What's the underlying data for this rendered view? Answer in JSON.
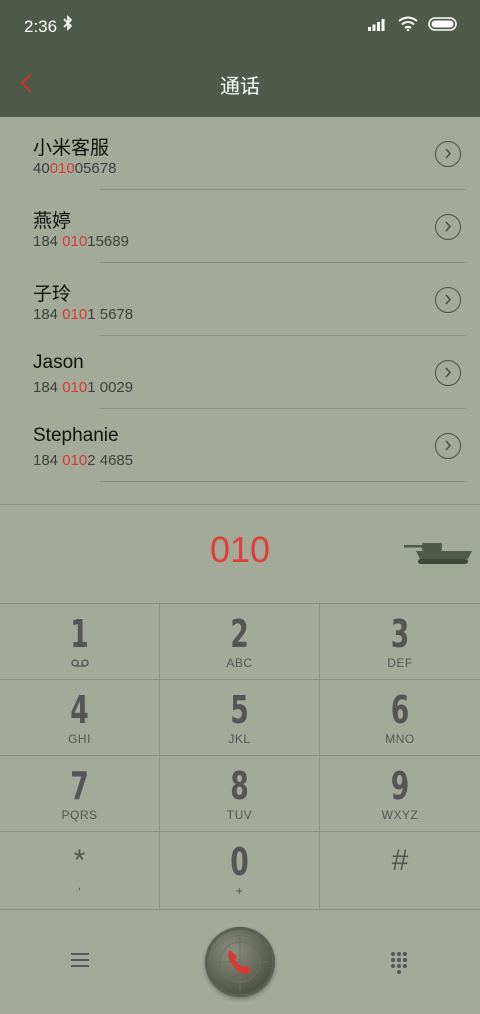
{
  "status": {
    "time": "2:36"
  },
  "header": {
    "title": "通话"
  },
  "contacts": [
    {
      "name": "小米客服",
      "num_pre": "40",
      "num_hl": "010",
      "num_post": "05678"
    },
    {
      "name": "燕婷",
      "num_pre": "184 ",
      "num_hl": "010",
      "num_post": "15689"
    },
    {
      "name": "子玲",
      "num_pre": "184 ",
      "num_hl": "010",
      "num_post": "1 5678"
    },
    {
      "name": "Jason",
      "num_pre": "184 ",
      "num_hl": "010",
      "num_post": "1 0029"
    },
    {
      "name": "Stephanie",
      "num_pre": "184 ",
      "num_hl": "010",
      "num_post": "2 4685"
    }
  ],
  "dial_input": {
    "value": "010"
  },
  "keypad": [
    {
      "digit": "1",
      "sub": ""
    },
    {
      "digit": "2",
      "sub": "ABC"
    },
    {
      "digit": "3",
      "sub": "DEF"
    },
    {
      "digit": "4",
      "sub": "GHI"
    },
    {
      "digit": "5",
      "sub": "JKL"
    },
    {
      "digit": "6",
      "sub": "MNO"
    },
    {
      "digit": "7",
      "sub": "PQRS"
    },
    {
      "digit": "8",
      "sub": "TUV"
    },
    {
      "digit": "9",
      "sub": "WXYZ"
    },
    {
      "digit": "*",
      "sub": ","
    },
    {
      "digit": "0",
      "sub": "+"
    },
    {
      "digit": "#",
      "sub": ""
    }
  ],
  "colors": {
    "header": "#4f5a4a",
    "background": "#a3aa98",
    "accent": "#e23b3b"
  }
}
